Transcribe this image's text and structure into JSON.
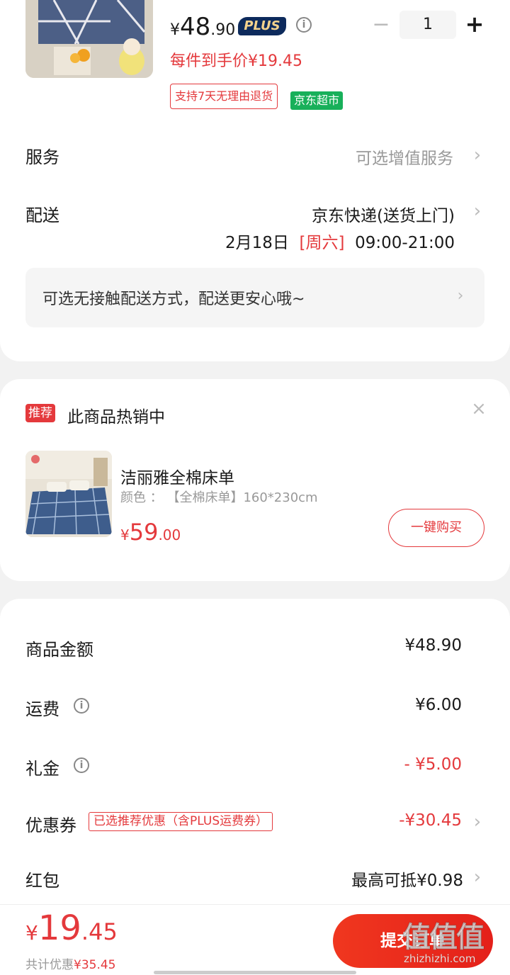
{
  "product": {
    "price_yen": "¥",
    "price_int": "48",
    "price_dec": ".90",
    "plus_badge": "PLUS",
    "info_glyph": "i",
    "each_price": "每件到手价¥19.45",
    "quantity": "1",
    "minus_glyph": "−",
    "plus_glyph": "+",
    "tag_return": "支持7天无理由退货",
    "tag_market": "京东超市"
  },
  "service": {
    "label": "服务",
    "value": "可选增值服务",
    "chevron": "›"
  },
  "delivery": {
    "label": "配送",
    "method": "京东快递(送货上门)",
    "date": "2月18日",
    "weekday": "[周六]",
    "time": "09:00-21:00",
    "chevron": "›",
    "contactless": "可选无接触配送方式，配送更安心哦~"
  },
  "recommend": {
    "badge": "推荐",
    "title": "此商品热销中",
    "close_glyph": "×",
    "name": "洁丽雅全棉床单",
    "spec": "颜色 ： 【全棉床单】160*230cm",
    "price_yen": "¥",
    "price_int": "59",
    "price_dec": ".00",
    "buy_label": "一键购买"
  },
  "summary": {
    "goods_label": "商品金额",
    "goods_value": "¥48.90",
    "shipping_label": "运费",
    "shipping_value": "¥6.00",
    "gift_label": "礼金",
    "gift_value": "- ¥5.00",
    "coupon_label": "优惠券",
    "coupon_tag": "已选推荐优惠（含PLUS运费券）",
    "coupon_value": "-¥30.45",
    "redpacket_label": "红包",
    "redpacket_value": "最高可抵¥0.98",
    "info_glyph": "i",
    "chevron": "›"
  },
  "footer": {
    "total_yen": "¥",
    "total_int": "19",
    "total_dec": ".45",
    "saving_prefix": "共计优惠",
    "saving_value": "¥35.45",
    "submit_label": "提交订单",
    "watermark_big": "值值值",
    "watermark_small": "zhizhizhi.com"
  },
  "colors": {
    "accent": "#e4393c",
    "market_green": "#18b05a",
    "plus_navy": "#0d2a5c"
  }
}
